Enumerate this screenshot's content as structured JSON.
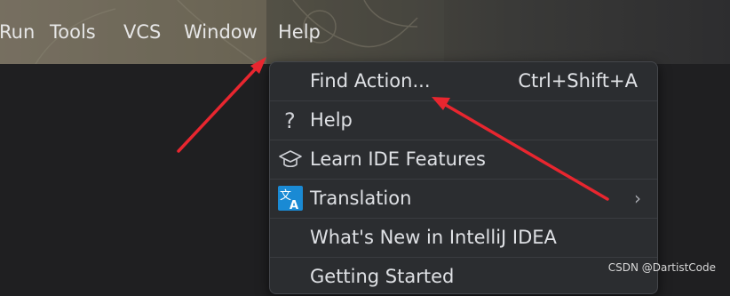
{
  "menubar": {
    "items": [
      {
        "label": "Run"
      },
      {
        "label": "Tools"
      },
      {
        "label": "VCS"
      },
      {
        "label": "Window"
      },
      {
        "label": "Help"
      }
    ]
  },
  "help_menu": {
    "items": [
      {
        "label": "Find Action...",
        "shortcut": "Ctrl+Shift+A",
        "icon": "none"
      },
      {
        "label": "Help",
        "icon": "question-mark-icon"
      },
      {
        "label": "Learn IDE Features",
        "icon": "graduation-cap-icon"
      },
      {
        "label": "Translation",
        "icon": "translate-icon",
        "submenu_arrow": "›"
      },
      {
        "label": "What's New in IntelliJ IDEA",
        "icon": "none"
      },
      {
        "label": "Getting Started",
        "icon": "none"
      }
    ]
  },
  "watermark": "CSDN @DartistCode",
  "colors": {
    "menu_bg": "#2b2d30",
    "menu_text": "#dfe1e5",
    "annotation_arrow": "#e8262f",
    "translate_icon": "#1a8ad4"
  }
}
